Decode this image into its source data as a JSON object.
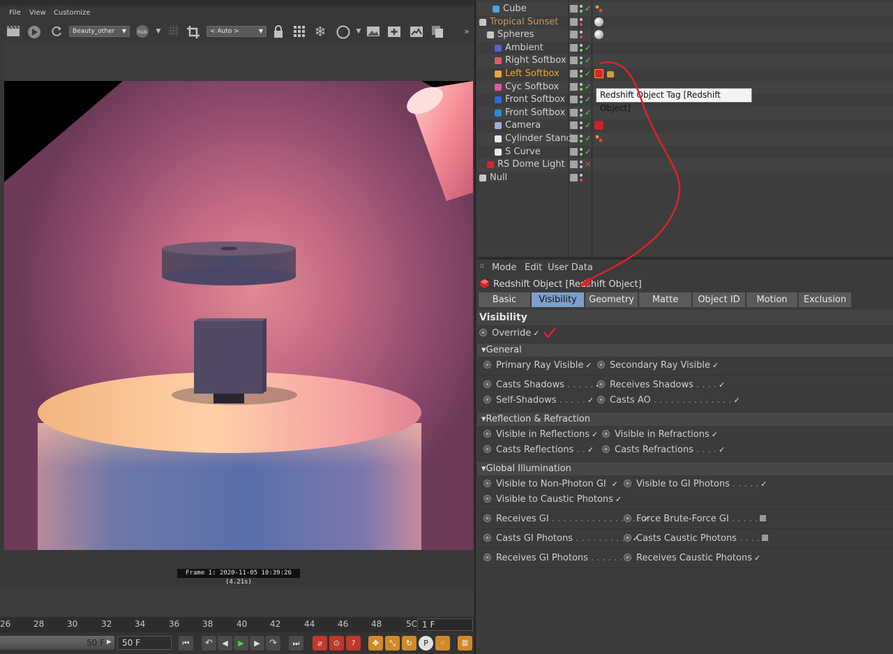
{
  "menu": {
    "file": "File",
    "view": "View",
    "customize": "Customize"
  },
  "toolbar": {
    "pass_select": "Beauty_other",
    "rgb_label": "RGB",
    "auto_select": "< Auto >",
    "more": "»"
  },
  "render": {
    "frame_info": "Frame  1:  2020-11-05  10:39:26  (4.21s)"
  },
  "timeline": {
    "ticks": [
      "26",
      "28",
      "30",
      "32",
      "34",
      "36",
      "38",
      "40",
      "42",
      "44",
      "46",
      "48",
      "5C"
    ],
    "current_frame": "1 F",
    "end_field_a": "50 F",
    "end_field_b": "50 F"
  },
  "objects": [
    {
      "name": "Cube",
      "indent": 1
    },
    {
      "name": "Tropical Sunset",
      "indent": 0
    },
    {
      "name": "Spheres",
      "indent": 1
    },
    {
      "name": "Ambient",
      "indent": 1
    },
    {
      "name": "Right Softbox",
      "indent": 1
    },
    {
      "name": "Left Softbox",
      "indent": 1
    },
    {
      "name": "Cyc Softbox",
      "indent": 1
    },
    {
      "name": "Front Softbox",
      "indent": 1
    },
    {
      "name": "Front Softbox",
      "indent": 1
    },
    {
      "name": "Camera",
      "indent": 1
    },
    {
      "name": "Cylinder Stand",
      "indent": 1
    },
    {
      "name": "S Curve",
      "indent": 1
    },
    {
      "name": "RS Dome Light",
      "indent": 0
    },
    {
      "name": "Null",
      "indent": 0
    }
  ],
  "tooltip": "Redshift Object Tag [Redshift Object]",
  "attr": {
    "menu": {
      "mode": "Mode",
      "edit": "Edit",
      "user_data": "User Data"
    },
    "title": "Redshift Object [Redshift Object]",
    "tabs": [
      "Basic",
      "Visibility",
      "Geometry",
      "Matte",
      "Object ID",
      "Motion Blur",
      "Exclusion"
    ],
    "selected_tab": "Visibility",
    "section": "Visibility",
    "override": "Override",
    "groups": {
      "general": "General",
      "reflection": "Reflection & Refraction",
      "gi": "Global Illumination"
    },
    "params": {
      "primary_ray": "Primary Ray Visible",
      "secondary_ray": "Secondary Ray Visible",
      "casts_shadows": "Casts Shadows",
      "receives_shadows": "Receives Shadows",
      "self_shadows": "Self-Shadows",
      "casts_ao": "Casts AO",
      "vis_reflections": "Visible in Reflections",
      "vis_refractions": "Visible in Refractions",
      "casts_reflections": "Casts Reflections",
      "casts_refractions": "Casts Refractions",
      "vis_nonphoton_gi": "Visible to Non-Photon GI",
      "vis_gi_photons": "Visible to GI Photons",
      "vis_caustic_photons": "Visible to Caustic Photons",
      "receives_gi": "Receives GI",
      "force_bruteforce": "Force Brute-Force GI",
      "casts_gi_photons": "Casts GI Photons",
      "casts_caustic_photons": "Casts Caustic Photons",
      "receives_gi_photons": "Receives GI Photons",
      "receives_caustic_photons": "Receives Caustic Photons"
    }
  },
  "colors": {
    "accent_tab": "#7d9ecb",
    "active_object": "#f6a623",
    "annotation": "#e0202a",
    "check_green": "#6fd66f"
  }
}
